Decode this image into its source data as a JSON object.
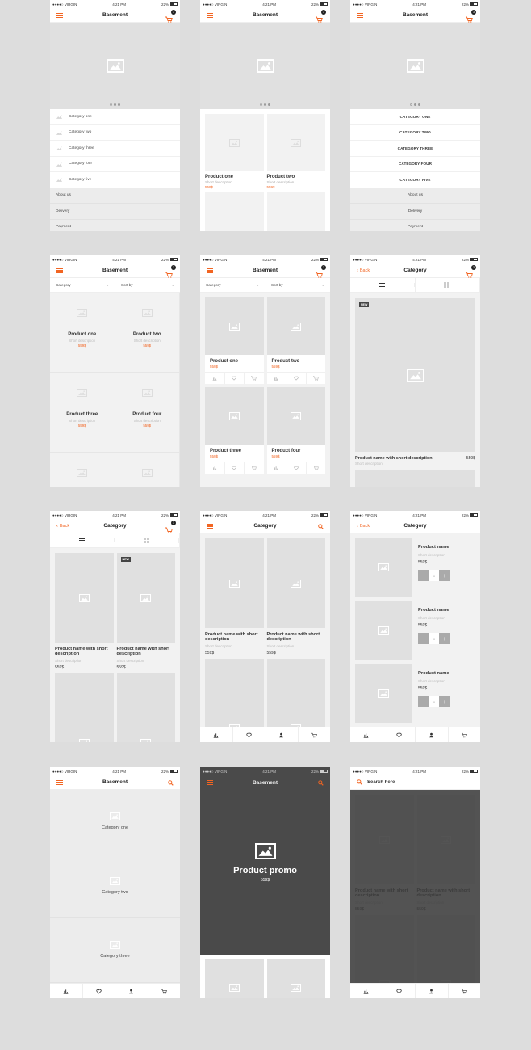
{
  "status_bar": {
    "carrier": "●●●●○ VIRGIN",
    "time": "4:21 PM",
    "battery": "22%"
  },
  "accent_color": "#f26522",
  "cart_count": "3",
  "screens": {
    "s1": {
      "title": "Basement",
      "categories": [
        "Category one",
        "Category two",
        "Category three",
        "Category four",
        "Category five"
      ],
      "links": [
        "About us",
        "Delivery",
        "Payment"
      ]
    },
    "s2": {
      "title": "Basement",
      "products": [
        {
          "name": "Product one",
          "desc": "Short description",
          "price": "559$"
        },
        {
          "name": "Product two",
          "desc": "Short description",
          "price": "559$"
        }
      ]
    },
    "s3": {
      "title": "Basement",
      "categories": [
        "CATEGORY ONE",
        "CATEGORY TWO",
        "CATEGORY THREE",
        "CATEGORY FOUR",
        "CATEGORY FIVE"
      ],
      "links": [
        "About us",
        "Delivery",
        "Payment"
      ]
    },
    "s4": {
      "title": "Basement",
      "filter_category": "Category",
      "filter_sort": "Sort by",
      "products": [
        {
          "name": "Product one",
          "desc": "Short description",
          "price": "559$"
        },
        {
          "name": "Product two",
          "desc": "Short description",
          "price": "559$"
        },
        {
          "name": "Product three",
          "desc": "Short description",
          "price": "559$"
        },
        {
          "name": "Product four",
          "desc": "Short description",
          "price": "559$"
        }
      ]
    },
    "s5": {
      "title": "Basement",
      "filter_category": "Category",
      "filter_sort": "Sort by",
      "products": [
        {
          "name": "Product one",
          "price": "559$"
        },
        {
          "name": "Product two",
          "price": "559$"
        },
        {
          "name": "Product three",
          "price": "559$"
        },
        {
          "name": "Product four",
          "price": "559$"
        }
      ]
    },
    "s6": {
      "back": "Back",
      "title": "Category",
      "badge": "NEW",
      "product": {
        "name": "Product name with short description",
        "desc": "Short description",
        "price": "559$"
      }
    },
    "s7": {
      "back": "Back",
      "title": "Category",
      "badge": "NEW",
      "products": [
        {
          "name": "Product name with short description",
          "desc": "Short description",
          "price": "559$"
        },
        {
          "name": "Product name with short description",
          "desc": "Short description",
          "price": "559$"
        }
      ]
    },
    "s8": {
      "title": "Category",
      "products": [
        {
          "name": "Product name with short description",
          "desc": "Short description",
          "price": "559$"
        },
        {
          "name": "Product name with short description",
          "desc": "Short description",
          "price": "559$"
        }
      ]
    },
    "s9": {
      "back": "Back",
      "title": "Category",
      "items": [
        {
          "name": "Product name",
          "desc": "Short description",
          "price": "559$",
          "qty": "0"
        },
        {
          "name": "Product name",
          "desc": "Short description",
          "price": "559$",
          "qty": "0"
        },
        {
          "name": "Product name",
          "desc": "Short description",
          "price": "559$",
          "qty": "0"
        }
      ]
    },
    "s10": {
      "title": "Basement",
      "categories": [
        "Category one",
        "Category two",
        "Category three"
      ]
    },
    "s11": {
      "title": "Basement",
      "promo_title": "Product promo",
      "promo_price": "559$"
    },
    "s12": {
      "search_placeholder": "Search here",
      "products": [
        {
          "name": "Product name with short description",
          "desc": "Short description",
          "price": "559$"
        },
        {
          "name": "Product name with short description",
          "desc": "Short description",
          "price": "559$"
        }
      ]
    }
  },
  "tabbar": [
    "stats-icon",
    "heart-icon",
    "user-icon",
    "cart-icon"
  ]
}
